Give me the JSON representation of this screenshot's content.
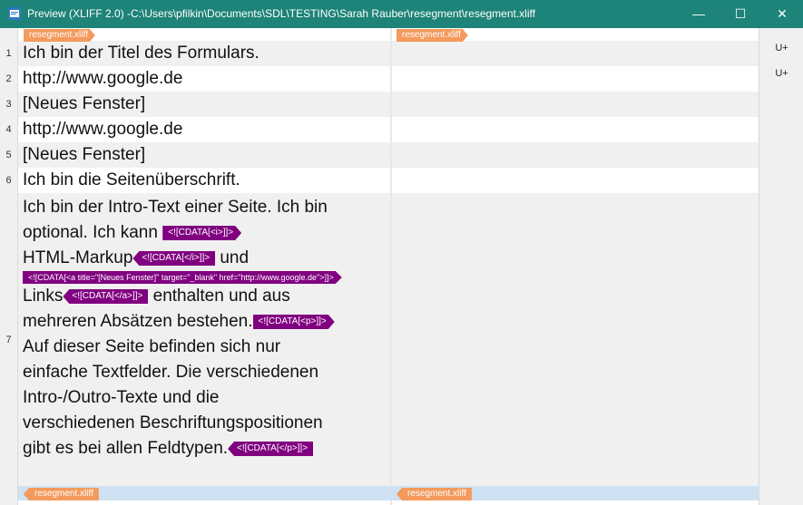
{
  "window": {
    "title": "Preview (XLIFF 2.0) -C:\\Users\\pfilkin\\Documents\\SDL\\TESTING\\Sarah Rauber\\resegment\\resegment.xliff",
    "minimize": "—",
    "maximize": "☐",
    "close": "✕"
  },
  "file_tag": "resegment.xliff",
  "side": [
    "U+",
    "U+"
  ],
  "rows": [
    {
      "num": "1",
      "text": "Ich bin der Titel des Formulars."
    },
    {
      "num": "2",
      "text": "http://www.google.de"
    },
    {
      "num": "3",
      "text": "[Neues Fenster]"
    },
    {
      "num": "4",
      "text": "http://www.google.de"
    },
    {
      "num": "5",
      "text": "[Neues Fenster]"
    },
    {
      "num": "6",
      "text": "Ich bin die Seitenüberschrift."
    }
  ],
  "segment7": {
    "num": "7",
    "l1": "Ich bin der Intro-Text einer Seite. Ich bin",
    "l2": "optional. Ich kann",
    "t1": "<![CDATA[<i>]]>",
    "l3": "HTML-Markup",
    "t2": "<![CDATA[</i>]]>",
    "l3b": "und",
    "t3": "<![CDATA[<a title=\"[Neues Fenster]\" target=\"_blank\" href=\"http://www.google.de\">]]>",
    "l4": "Links",
    "t4": "<![CDATA[</a>]]>",
    "l4b": "enthalten und aus",
    "l5": "mehreren Absätzen bestehen.",
    "t5": "<![CDATA[<p>]]>",
    "l6": "Auf dieser Seite befinden sich nur",
    "l7": "einfache Textfelder. Die verschiedenen",
    "l8": "Intro-/Outro-Texte und die",
    "l9": "verschiedenen Beschriftungspositionen",
    "l10": "gibt es bei allen Feldtypen.",
    "t6": "<![CDATA[</p>]]>"
  }
}
